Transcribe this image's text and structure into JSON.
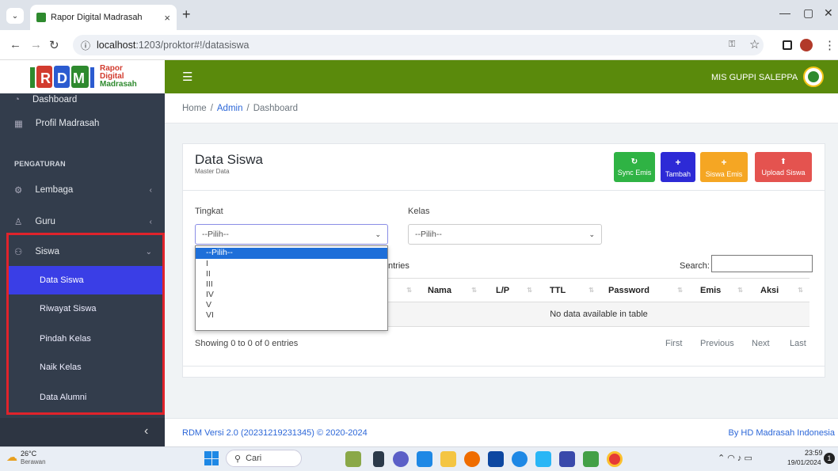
{
  "browser": {
    "tab_title": "Rapor Digital Madrasah",
    "url_host": "localhost",
    "url_rest": ":1203/proktor#!/datasiswa",
    "new_tab": "+",
    "close_tab": "×"
  },
  "logo": {
    "line1": "Rapor",
    "line2": "Digital",
    "line3": "Madrasah"
  },
  "sidebar": {
    "items": [
      {
        "label": "Dashboard"
      },
      {
        "label": "Profil Madrasah"
      }
    ],
    "section": "PENGATURAN",
    "settings": [
      {
        "label": "Lembaga"
      },
      {
        "label": "Guru"
      },
      {
        "label": "Siswa"
      }
    ],
    "siswa_sub": [
      {
        "label": "Data Siswa"
      },
      {
        "label": "Riwayat Siswa"
      },
      {
        "label": "Pindah Kelas"
      },
      {
        "label": "Naik Kelas"
      },
      {
        "label": "Data Alumni"
      }
    ],
    "collapse_icon": "‹"
  },
  "topbar": {
    "school": "MIS GUPPI SALEPPA",
    "menu_icon": "☰"
  },
  "breadcrumb": {
    "home": "Home",
    "sep": "/",
    "admin": "Admin",
    "current": "Dashboard"
  },
  "card": {
    "title": "Data Siswa",
    "subtitle": "Master Data",
    "buttons": [
      {
        "label": "Sync Emis",
        "icon": "↻",
        "color": "#2fb344"
      },
      {
        "label": "Tambah",
        "icon": "+",
        "color": "#2d2ad6"
      },
      {
        "label": "Siswa Emis",
        "icon": "+",
        "color": "#f5a623"
      },
      {
        "label": "Upload Siswa",
        "icon": "⬆",
        "color": "#e4534f"
      }
    ]
  },
  "filters": {
    "tingkat_label": "Tingkat",
    "tingkat_value": "--Pilih--",
    "kelas_label": "Kelas",
    "kelas_value": "--Pilih--",
    "tingkat_options": [
      "--Pilih--",
      "I",
      "II",
      "III",
      "IV",
      "V",
      "VI"
    ]
  },
  "table": {
    "entries_text": "ntries",
    "search_label": "Search:",
    "columns": [
      "Nama",
      "L/P",
      "TTL",
      "Password",
      "Emis",
      "Aksi"
    ],
    "empty": "No data available in table",
    "info": "Showing 0 to 0 of 0 entries",
    "pagination": [
      "First",
      "Previous",
      "Next",
      "Last"
    ]
  },
  "footer": {
    "left": "RDM Versi 2.0 (20231219231345) © 2020-2024",
    "right": "By HD Madrasah Indonesia"
  },
  "taskbar": {
    "temp": "26°C",
    "weather": "Berawan",
    "search": "Cari",
    "time": "23:59",
    "date": "19/01/2024",
    "notif": "1"
  }
}
